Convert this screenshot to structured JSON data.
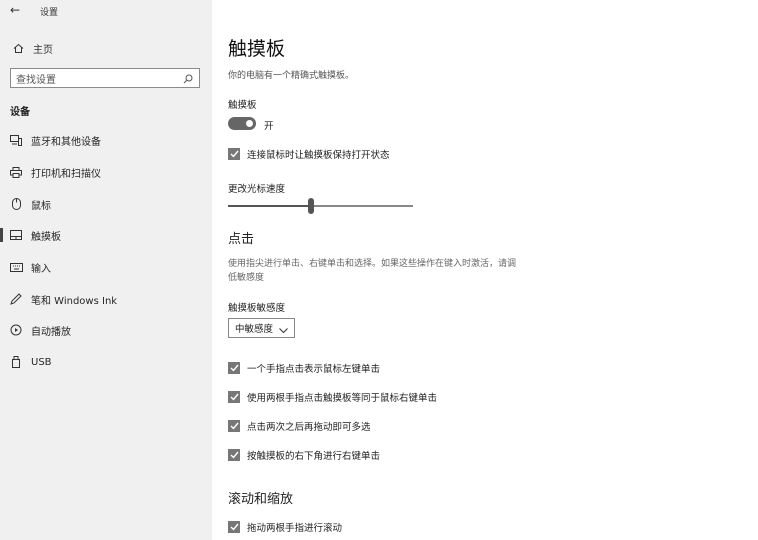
{
  "window": {
    "title": "设置"
  },
  "sidebar": {
    "home_label": "主页",
    "search_placeholder": "查找设置",
    "section_label": "设备",
    "items": [
      {
        "label": "蓝牙和其他设备",
        "icon": "bluetooth-devices-icon"
      },
      {
        "label": "打印机和扫描仪",
        "icon": "printer-icon"
      },
      {
        "label": "鼠标",
        "icon": "mouse-icon"
      },
      {
        "label": "触摸板",
        "icon": "touchpad-icon",
        "selected": true
      },
      {
        "label": "输入",
        "icon": "keyboard-icon"
      },
      {
        "label": "笔和 Windows Ink",
        "icon": "pen-icon"
      },
      {
        "label": "自动播放",
        "icon": "autoplay-icon"
      },
      {
        "label": "USB",
        "icon": "usb-icon"
      }
    ]
  },
  "main": {
    "title": "触摸板",
    "subtitle": "你的电脑有一个精确式触摸板。",
    "touchpad_label": "触摸板",
    "toggle_state": "开",
    "toggle_on": true,
    "keep_on_with_mouse": "连接鼠标时让触摸板保持打开状态",
    "cursor_speed_label": "更改光标速度",
    "cursor_speed_level": 0.45,
    "taps_heading": "点击",
    "taps_description": "使用指尖进行单击、右键单击和选择。如果这些操作在键入时激活，请调低敏感度",
    "sensitivity_label": "触摸板敏感度",
    "sensitivity_value": "中敏感度",
    "tap_options": [
      "一个手指点击表示鼠标左键单击",
      "使用两根手指点击触摸板等同于鼠标右键单击",
      "点击两次之后再拖动即可多选",
      "按触摸板的右下角进行右键单击"
    ],
    "scroll_heading": "滚动和缩放",
    "scroll_options": [
      "拖动两根手指进行滚动"
    ]
  }
}
